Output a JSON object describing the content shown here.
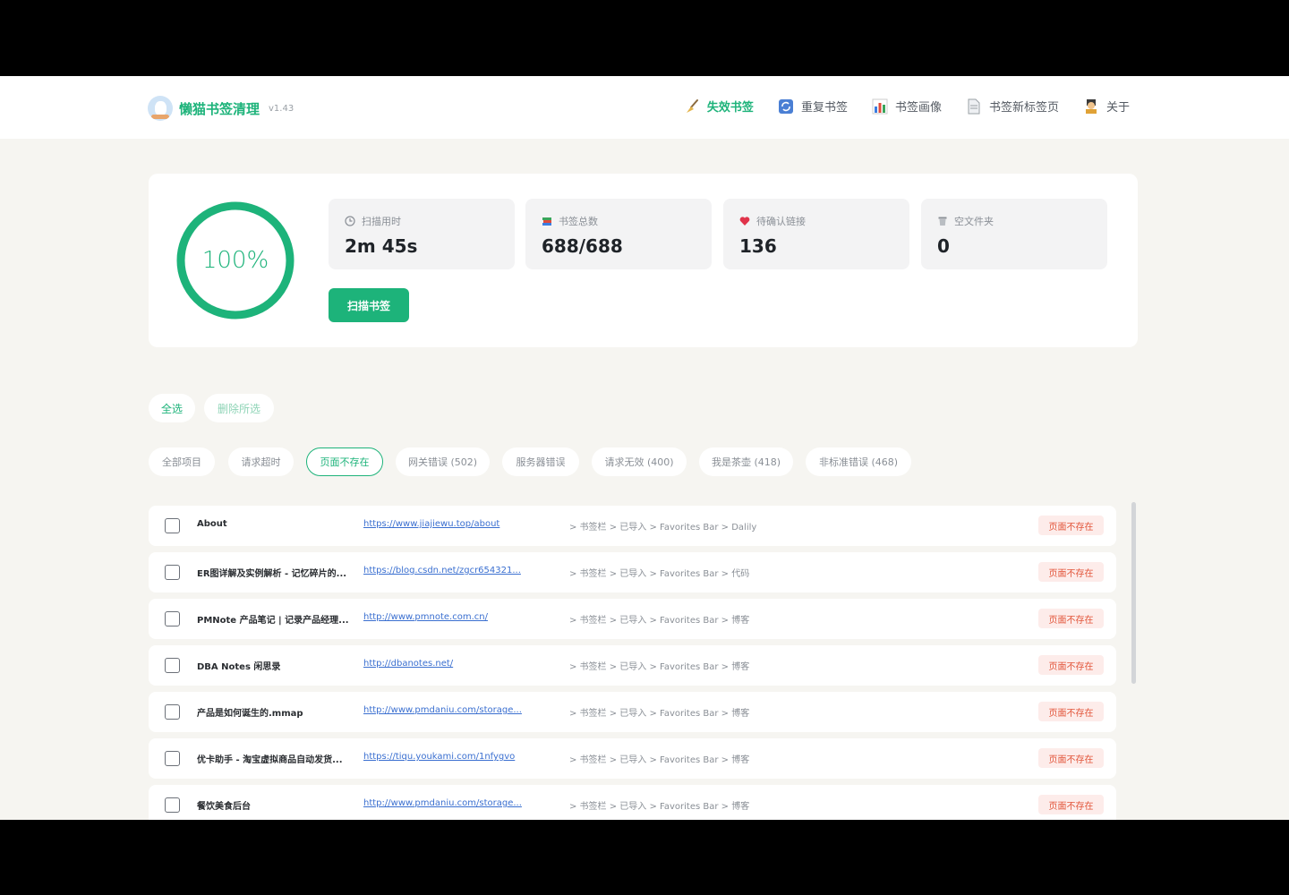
{
  "app": {
    "name": "懒猫书签清理",
    "version": "v1.43"
  },
  "nav": [
    {
      "label": "失效书签",
      "icon": "broom-icon",
      "active": true
    },
    {
      "label": "重复书签",
      "icon": "refresh-icon",
      "active": false
    },
    {
      "label": "书签画像",
      "icon": "bar-chart-icon",
      "active": false
    },
    {
      "label": "书签新标签页",
      "icon": "page-icon",
      "active": false
    },
    {
      "label": "关于",
      "icon": "person-icon",
      "active": false
    }
  ],
  "progress": {
    "percent_text": "100%",
    "value": 1.0
  },
  "stats": [
    {
      "label": "扫描用时",
      "value": "2m 45s",
      "icon": "clock-icon"
    },
    {
      "label": "书签总数",
      "value": "688/688",
      "icon": "books-icon"
    },
    {
      "label": "待确认链接",
      "value": "136",
      "icon": "heart-icon"
    },
    {
      "label": "空文件夹",
      "value": "0",
      "icon": "trash-icon"
    }
  ],
  "scan_button": "扫描书签",
  "actions": {
    "select_all": "全选",
    "delete_selected": "删除所选"
  },
  "filters": [
    {
      "label": "全部项目",
      "active": false
    },
    {
      "label": "请求超时",
      "active": false
    },
    {
      "label": "页面不存在",
      "active": true
    },
    {
      "label": "网关错误 (502)",
      "active": false
    },
    {
      "label": "服务器错误",
      "active": false
    },
    {
      "label": "请求无效 (400)",
      "active": false
    },
    {
      "label": "我是茶壶 (418)",
      "active": false
    },
    {
      "label": "非标准错误 (468)",
      "active": false
    }
  ],
  "rows": [
    {
      "title": "About",
      "url": "https://www.jiajiewu.top/about",
      "path": "> 书签栏 > 已导入 > Favorites Bar > Dalily",
      "status": "页面不存在"
    },
    {
      "title": "ER图详解及实例解析 - 记忆碎片的...",
      "url": "https://blog.csdn.net/zgcr654321...",
      "path": "> 书签栏 > 已导入 > Favorites Bar > 代码",
      "status": "页面不存在"
    },
    {
      "title": "PMNote 产品笔记 | 记录产品经理...",
      "url": "http://www.pmnote.com.cn/",
      "path": "> 书签栏 > 已导入 > Favorites Bar > 博客",
      "status": "页面不存在"
    },
    {
      "title": "DBA Notes 闲思录",
      "url": "http://dbanotes.net/",
      "path": "> 书签栏 > 已导入 > Favorites Bar > 博客",
      "status": "页面不存在"
    },
    {
      "title": "产品是如何诞生的.mmap",
      "url": "http://www.pmdaniu.com/storage...",
      "path": "> 书签栏 > 已导入 > Favorites Bar > 博客",
      "status": "页面不存在"
    },
    {
      "title": "优卡助手 - 淘宝虚拟商品自动发货...",
      "url": "https://tiqu.youkami.com/1nfygvo",
      "path": "> 书签栏 > 已导入 > Favorites Bar > 博客",
      "status": "页面不存在"
    },
    {
      "title": "餐饮美食后台",
      "url": "http://www.pmdaniu.com/storage...",
      "path": "> 书签栏 > 已导入 > Favorites Bar > 博客",
      "status": "页面不存在"
    }
  ],
  "colors": {
    "accent": "#1db37a",
    "link": "#3a6fd0",
    "badge_bg": "#fdecea",
    "badge_text": "#e2553a",
    "background": "#f6f5f1"
  }
}
